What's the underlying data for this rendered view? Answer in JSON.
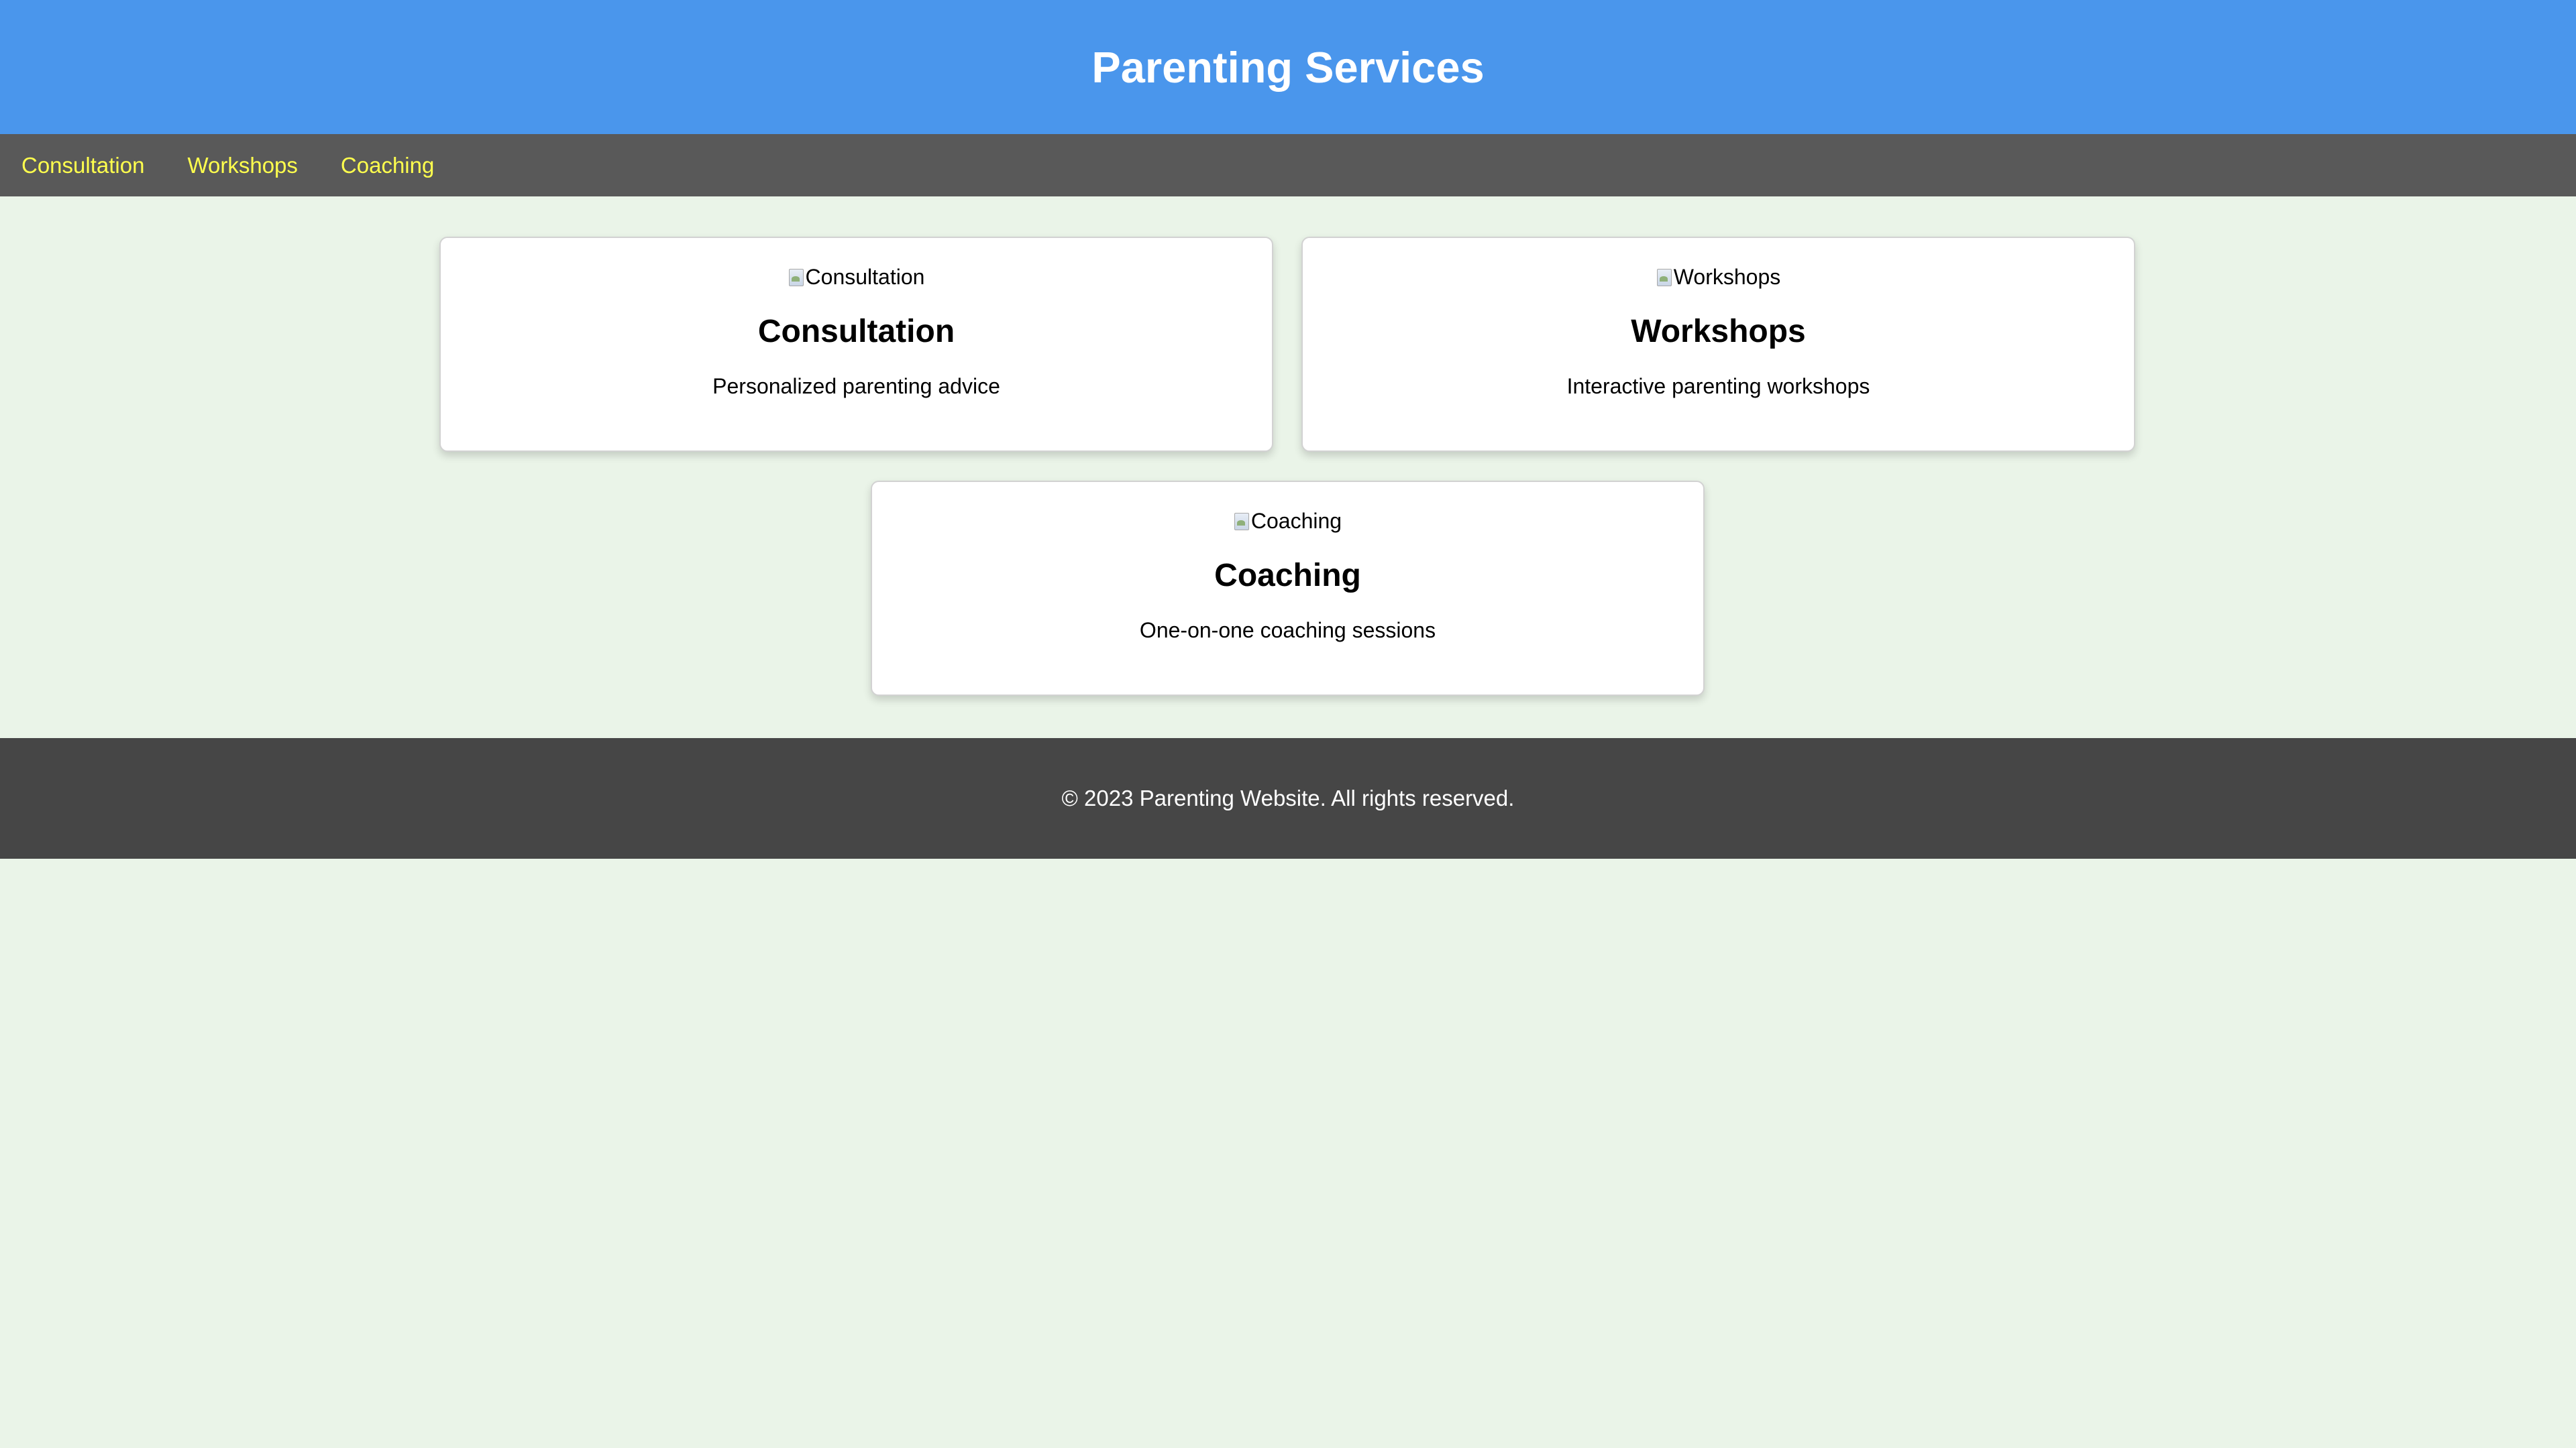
{
  "header": {
    "title": "Parenting Services",
    "bg_color": "#4a96ec"
  },
  "nav": {
    "items": [
      {
        "label": "Consultation"
      },
      {
        "label": "Workshops"
      },
      {
        "label": "Coaching"
      }
    ],
    "link_color": "#ffff4d",
    "bg_color": "#595959"
  },
  "services": [
    {
      "image_alt": "Consultation",
      "title": "Consultation",
      "description": "Personalized parenting advice"
    },
    {
      "image_alt": "Workshops",
      "title": "Workshops",
      "description": "Interactive parenting workshops"
    },
    {
      "image_alt": "Coaching",
      "title": "Coaching",
      "description": "One-on-one coaching sessions"
    }
  ],
  "footer": {
    "copyright": "© 2023 Parenting Website. All rights reserved.",
    "bg_color": "#464646"
  },
  "page_bg_color": "#eaf4e8"
}
